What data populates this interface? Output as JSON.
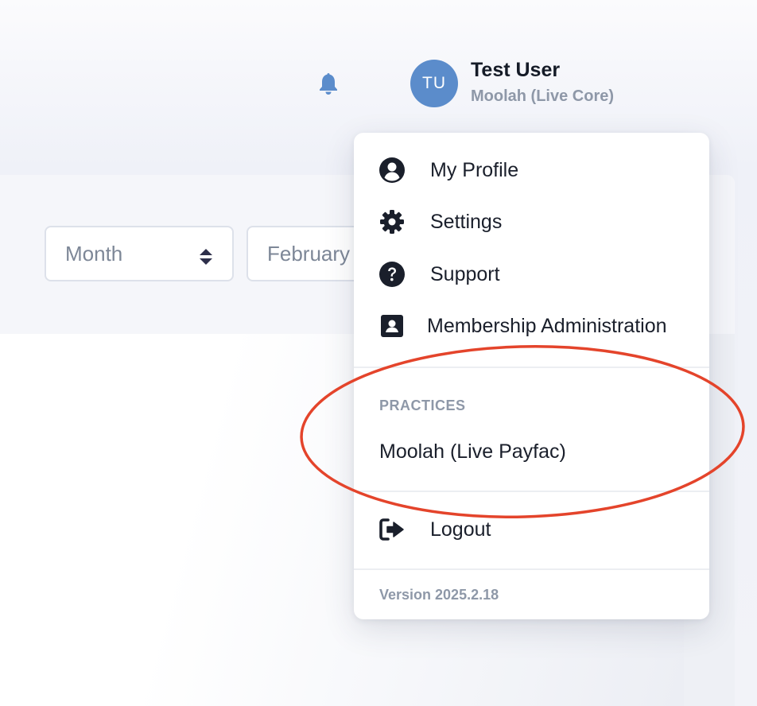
{
  "header": {
    "notification_icon": "bell-icon",
    "user": {
      "initials": "TU",
      "name": "Test User",
      "organization": "Moolah (Live Core)"
    }
  },
  "filters": {
    "period_select": {
      "value": "Month",
      "icon": "sort-arrows-icon"
    },
    "month_select": {
      "value": "February"
    }
  },
  "dropdown": {
    "items": [
      {
        "label": "My Profile",
        "icon": "user-circle-icon"
      },
      {
        "label": "Settings",
        "icon": "gear-icon"
      },
      {
        "label": "Support",
        "icon": "question-circle-icon"
      },
      {
        "label": "Membership Administration",
        "icon": "id-badge-icon"
      }
    ],
    "practices": {
      "heading": "PRACTICES",
      "items": [
        "Moolah (Live Payfac)"
      ]
    },
    "logout": {
      "label": "Logout",
      "icon": "sign-out-icon"
    },
    "version": "Version 2025.2.18"
  },
  "colors": {
    "avatar": "#5b8ccb",
    "bell": "#5b8ccb",
    "annotation": "#e4442b",
    "muted_text": "#8e98a8",
    "primary_text": "#1a1f2b"
  }
}
